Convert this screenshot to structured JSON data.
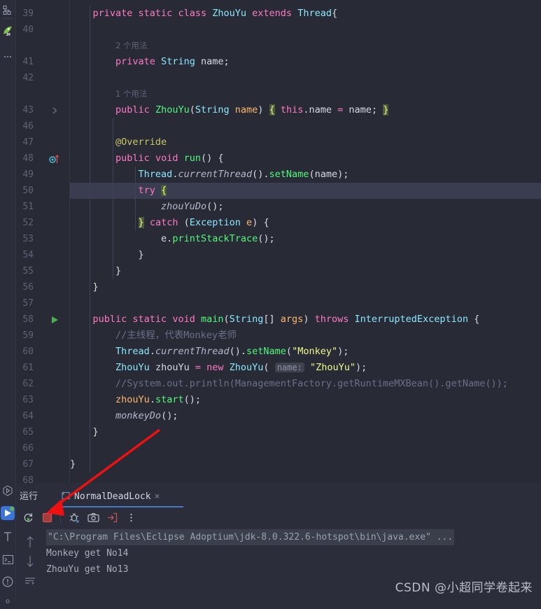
{
  "theme": {
    "editor_bg": "#282a36",
    "panel_bg": "#2b2d3a",
    "caret_line_bg": "#3a3d50",
    "accent_blue": "#4577c4",
    "annotation_red": "#ee1111",
    "keyword": "#ff79c6",
    "type": "#8be9fd",
    "string": "#f1fa8c",
    "comment": "#6b7089",
    "method": "#50fa7b",
    "number": "#bd93f9",
    "param": "#ffb86c"
  },
  "tool_strip": {
    "top_icons": [
      {
        "name": "structure-icon",
        "glyph": "structure"
      },
      {
        "name": "jrebel-icon",
        "glyph": "rocket"
      },
      {
        "name": "more-tools-icon",
        "glyph": "ellipsis"
      }
    ],
    "bottom_icons": [
      {
        "name": "run-tool-icon",
        "glyph": "hex-play"
      },
      {
        "name": "run-panel-icon",
        "glyph": "play-badge",
        "active": true
      },
      {
        "name": "build-icon",
        "glyph": "hammer"
      },
      {
        "name": "terminal-icon",
        "glyph": "terminal"
      },
      {
        "name": "problems-icon",
        "glyph": "exclamation-circle"
      },
      {
        "name": "settings-icon",
        "glyph": "gear"
      }
    ]
  },
  "editor": {
    "caret_line": 50,
    "lines": [
      {
        "num": "39",
        "mark": "",
        "indent": 1,
        "tokens": [
          {
            "t": "private ",
            "c": "kw"
          },
          {
            "t": "static ",
            "c": "kw"
          },
          {
            "t": "class ",
            "c": "kw"
          },
          {
            "t": "ZhouYu",
            "c": "type"
          },
          {
            "t": " ",
            "c": "punc"
          },
          {
            "t": "extends ",
            "c": "kw"
          },
          {
            "t": "Thread",
            "c": "type"
          },
          {
            "t": "{",
            "c": "punc"
          }
        ]
      },
      {
        "num": "40",
        "mark": "",
        "indent": 1,
        "tokens": []
      },
      {
        "num": "",
        "mark": "",
        "indent": 2,
        "usage": "2 个用法"
      },
      {
        "num": "41",
        "mark": "",
        "indent": 2,
        "tokens": [
          {
            "t": "private ",
            "c": "kw"
          },
          {
            "t": "String",
            "c": "type"
          },
          {
            "t": " name;",
            "c": "punc"
          }
        ]
      },
      {
        "num": "42",
        "mark": "",
        "indent": 2,
        "tokens": []
      },
      {
        "num": "",
        "mark": "",
        "indent": 2,
        "usage": "1 个用法"
      },
      {
        "num": "43",
        "mark": "chevron",
        "indent": 2,
        "tokens": [
          {
            "t": "public ",
            "c": "kw"
          },
          {
            "t": "ZhouYu",
            "c": "cls"
          },
          {
            "t": "(",
            "c": "punc"
          },
          {
            "t": "String",
            "c": "type"
          },
          {
            "t": " ",
            "c": "punc"
          },
          {
            "t": "name",
            "c": "param"
          },
          {
            "t": ")",
            "c": "punc"
          },
          {
            "t": " ",
            "c": "punc"
          },
          {
            "t": "{",
            "c": "brace-hl"
          },
          {
            "t": " ",
            "c": "punc"
          },
          {
            "t": "this",
            "c": "kw"
          },
          {
            "t": ".name ",
            "c": "punc"
          },
          {
            "t": "=",
            "c": "op"
          },
          {
            "t": " name; ",
            "c": "punc"
          },
          {
            "t": "}",
            "c": "brace-hl"
          }
        ]
      },
      {
        "num": "46",
        "mark": "",
        "indent": 2,
        "tokens": []
      },
      {
        "num": "47",
        "mark": "",
        "indent": 2,
        "tokens": [
          {
            "t": "@Override",
            "c": "anno"
          }
        ]
      },
      {
        "num": "48",
        "mark": "override",
        "indent": 2,
        "tokens": [
          {
            "t": "public ",
            "c": "kw"
          },
          {
            "t": "void ",
            "c": "kw"
          },
          {
            "t": "run",
            "c": "fn"
          },
          {
            "t": "() {",
            "c": "punc"
          }
        ]
      },
      {
        "num": "49",
        "mark": "",
        "indent": 3,
        "tokens": [
          {
            "t": "Thread",
            "c": "type"
          },
          {
            "t": ".",
            "c": "punc"
          },
          {
            "t": "currentThread",
            "c": "fnit"
          },
          {
            "t": "().",
            "c": "punc"
          },
          {
            "t": "setName",
            "c": "fn"
          },
          {
            "t": "(name);",
            "c": "punc"
          }
        ]
      },
      {
        "num": "50",
        "mark": "",
        "indent": 3,
        "caret": true,
        "tokens": [
          {
            "t": "try ",
            "c": "kw"
          },
          {
            "t": "{",
            "c": "brace-hl"
          }
        ]
      },
      {
        "num": "51",
        "mark": "",
        "indent": 4,
        "tokens": [
          {
            "t": "zhouYuDo",
            "c": "fnit"
          },
          {
            "t": "();",
            "c": "punc"
          }
        ]
      },
      {
        "num": "52",
        "mark": "",
        "indent": 3,
        "tokens": [
          {
            "t": "}",
            "c": "brace-hl"
          },
          {
            "t": " ",
            "c": "punc"
          },
          {
            "t": "catch ",
            "c": "kw"
          },
          {
            "t": "(",
            "c": "punc"
          },
          {
            "t": "Exception",
            "c": "type"
          },
          {
            "t": " ",
            "c": "punc"
          },
          {
            "t": "e",
            "c": "param"
          },
          {
            "t": ") {",
            "c": "punc"
          }
        ]
      },
      {
        "num": "53",
        "mark": "",
        "indent": 4,
        "tokens": [
          {
            "t": "e.",
            "c": "punc"
          },
          {
            "t": "printStackTrace",
            "c": "fn"
          },
          {
            "t": "();",
            "c": "punc"
          }
        ]
      },
      {
        "num": "54",
        "mark": "",
        "indent": 3,
        "tokens": [
          {
            "t": "}",
            "c": "punc"
          }
        ]
      },
      {
        "num": "55",
        "mark": "",
        "indent": 2,
        "tokens": [
          {
            "t": "}",
            "c": "punc"
          }
        ]
      },
      {
        "num": "56",
        "mark": "",
        "indent": 1,
        "tokens": [
          {
            "t": "}",
            "c": "punc"
          }
        ]
      },
      {
        "num": "57",
        "mark": "",
        "indent": 1,
        "tokens": []
      },
      {
        "num": "58",
        "mark": "run",
        "indent": 1,
        "tokens": [
          {
            "t": "public ",
            "c": "kw"
          },
          {
            "t": "static ",
            "c": "kw"
          },
          {
            "t": "void ",
            "c": "kw"
          },
          {
            "t": "main",
            "c": "fn"
          },
          {
            "t": "(",
            "c": "punc"
          },
          {
            "t": "String",
            "c": "type"
          },
          {
            "t": "[] ",
            "c": "punc"
          },
          {
            "t": "args",
            "c": "param"
          },
          {
            "t": ") ",
            "c": "punc"
          },
          {
            "t": "throws ",
            "c": "kw"
          },
          {
            "t": "InterruptedException",
            "c": "type"
          },
          {
            "t": " {",
            "c": "punc"
          }
        ]
      },
      {
        "num": "59",
        "mark": "",
        "indent": 2,
        "tokens": [
          {
            "t": "//主线程，代表Monkey老师",
            "c": "cmt"
          }
        ]
      },
      {
        "num": "60",
        "mark": "",
        "indent": 2,
        "tokens": [
          {
            "t": "Thread",
            "c": "type"
          },
          {
            "t": ".",
            "c": "punc"
          },
          {
            "t": "currentThread",
            "c": "fnit"
          },
          {
            "t": "().",
            "c": "punc"
          },
          {
            "t": "setName",
            "c": "fn"
          },
          {
            "t": "(",
            "c": "punc"
          },
          {
            "t": "\"Monkey\"",
            "c": "str"
          },
          {
            "t": ");",
            "c": "punc"
          }
        ]
      },
      {
        "num": "61",
        "mark": "",
        "indent": 2,
        "tokens": [
          {
            "t": "ZhouYu",
            "c": "type"
          },
          {
            "t": " zhouYu ",
            "c": "punc"
          },
          {
            "t": "=",
            "c": "op"
          },
          {
            "t": " ",
            "c": "punc"
          },
          {
            "t": "new ",
            "c": "kw"
          },
          {
            "t": "ZhouYu",
            "c": "type"
          },
          {
            "t": "( ",
            "c": "punc"
          },
          {
            "t": "name:",
            "c": "hint"
          },
          {
            "t": " ",
            "c": "punc"
          },
          {
            "t": "\"ZhouYu\"",
            "c": "str"
          },
          {
            "t": ");",
            "c": "punc"
          }
        ]
      },
      {
        "num": "62",
        "mark": "",
        "indent": 2,
        "tokens": [
          {
            "t": "//System.out.println(ManagementFactory.getRuntimeMXBean().getName());",
            "c": "cmt"
          }
        ]
      },
      {
        "num": "63",
        "mark": "",
        "indent": 2,
        "tokens": [
          {
            "t": "zhouYu",
            "c": "vfield"
          },
          {
            "t": ".",
            "c": "punc"
          },
          {
            "t": "start",
            "c": "fn"
          },
          {
            "t": "();",
            "c": "punc"
          }
        ]
      },
      {
        "num": "64",
        "mark": "",
        "indent": 2,
        "tokens": [
          {
            "t": "monkeyDo",
            "c": "fnit"
          },
          {
            "t": "();",
            "c": "punc"
          }
        ]
      },
      {
        "num": "65",
        "mark": "",
        "indent": 1,
        "tokens": [
          {
            "t": "}",
            "c": "punc"
          }
        ]
      },
      {
        "num": "66",
        "mark": "",
        "indent": 1,
        "tokens": []
      },
      {
        "num": "67",
        "mark": "",
        "indent": 0,
        "tokens": [
          {
            "t": "}",
            "c": "punc"
          }
        ]
      },
      {
        "num": "68",
        "mark": "",
        "indent": 0,
        "tokens": []
      }
    ]
  },
  "run_panel": {
    "title": "运行",
    "tab": {
      "label": "NormalDeadLock",
      "close_label": "×",
      "icon": "java-class-icon"
    },
    "toolbar": [
      {
        "name": "rerun-button",
        "glyph": "rerun",
        "title": "Rerun"
      },
      {
        "name": "stop-button",
        "glyph": "stop",
        "title": "Stop"
      },
      {
        "name": "debug-button",
        "glyph": "bug",
        "title": "Debug"
      },
      {
        "name": "snapshot-button",
        "glyph": "camera",
        "title": "Snapshot"
      },
      {
        "name": "export-button",
        "glyph": "export",
        "title": "Export"
      },
      {
        "name": "more-options-button",
        "glyph": "kebab",
        "title": "More"
      }
    ],
    "side_buttons": [
      {
        "name": "scroll-up-button",
        "glyph": "arrow-up"
      },
      {
        "name": "scroll-down-button",
        "glyph": "arrow-down"
      },
      {
        "name": "soft-wrap-button",
        "glyph": "wrap"
      }
    ],
    "console_lines": [
      {
        "text": "\"C:\\Program Files\\Eclipse Adoptium\\jdk-8.0.322.6-hotspot\\bin\\java.exe\" ...",
        "cmd": true
      },
      {
        "text": "Monkey get No14",
        "cmd": false
      },
      {
        "text": "ZhouYu get No13",
        "cmd": false
      }
    ]
  },
  "watermark": "CSDN @小超同学卷起来"
}
